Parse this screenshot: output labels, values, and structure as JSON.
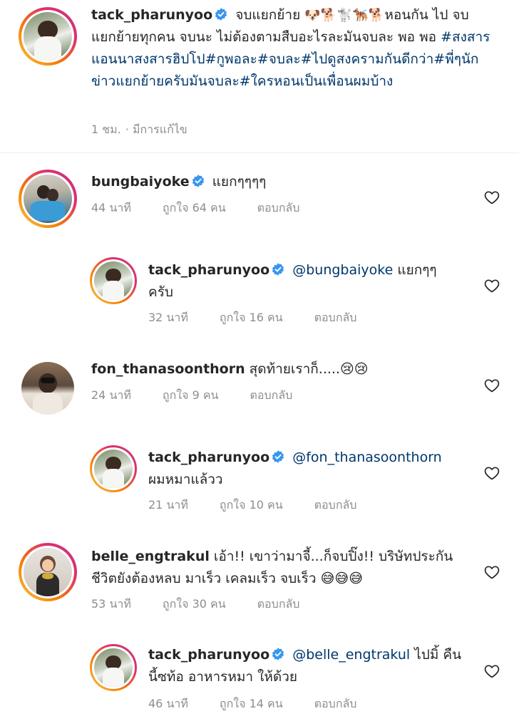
{
  "caption": {
    "username": "tack_pharunyoo",
    "text_start": "จบแยกย้าย",
    "emojis": "🐶🐕🐩🐕‍🦺🐕",
    "text_mid": "หอนกัน ไป จบแยกย้ายทุกคน จบนะ ไม่ต้องตามสืบอะไรละมันจบละ พอ พอ ",
    "hashtags": "#สงสารแอนนาสงสารฮิปโป#กูพอละ#จบละ#ไปดูสงครามกันดีกว่า#พี่ๆนักข่าวแยกย้ายครับมันจบละ#ใครหอนเป็นเพื่อนผมบ้าง",
    "time": "1 ชม.",
    "edited": "· มีการแก้ไข"
  },
  "comments": [
    {
      "username": "bungbaiyoke",
      "verified": true,
      "mention": "",
      "text": "แยกๆๆๆๆ",
      "time": "44 นาที",
      "likes": "ถูกใจ 64 คน",
      "reply": "ตอบกลับ"
    },
    {
      "username": "tack_pharunyoo",
      "verified": true,
      "mention": "@bungbaiyoke",
      "text": "แยกๆๆ ครับ",
      "time": "32 นาที",
      "likes": "ถูกใจ 16 คน",
      "reply": "ตอบกลับ"
    },
    {
      "username": "fon_thanasoonthorn",
      "verified": false,
      "mention": "",
      "text": "สุดท้ายเราก็.....😢😢",
      "time": "24 นาที",
      "likes": "ถูกใจ 9 คน",
      "reply": "ตอบกลับ"
    },
    {
      "username": "tack_pharunyoo",
      "verified": true,
      "mention": "@fon_thanasoonthorn",
      "text": "ผมหมาแล้วว",
      "time": "21 นาที",
      "likes": "ถูกใจ 10 คน",
      "reply": "ตอบกลับ"
    },
    {
      "username": "belle_engtrakul",
      "verified": false,
      "mention": "",
      "text": "เอ้า!! เขาว่ามาจี้...ก็จบปิ๊ง!! บริษัทประกันชีวิตยังต้องหลบ มาเร็ว เคลมเร็ว จบเร็ว 😅😅😅",
      "time": "53 นาที",
      "likes": "ถูกใจ 30 คน",
      "reply": "ตอบกลับ"
    },
    {
      "username": "tack_pharunyoo",
      "verified": true,
      "mention": "@belle_engtrakul",
      "text": "ไปมิ้ คืนนี้ซท้อ อาหารหมา ให้ด้วย",
      "time": "46 นาที",
      "likes": "ถูกใจ 14 คน",
      "reply": "ตอบกลับ"
    }
  ],
  "icons": {
    "verified": "verified-badge-icon",
    "heart": "heart-outline-icon"
  },
  "colors": {
    "verified": "#3897f0",
    "link": "#00376b",
    "muted": "#8e8e8e"
  }
}
